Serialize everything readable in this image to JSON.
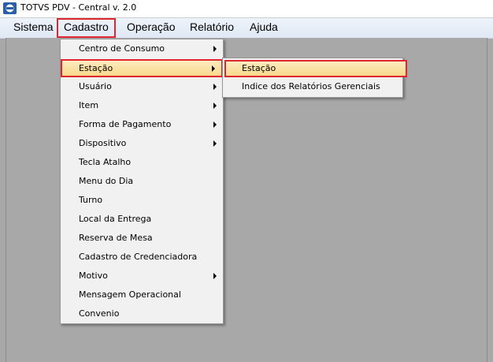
{
  "window": {
    "title": "TOTVS PDV - Central v. 2.0",
    "icon": "app-logo-icon"
  },
  "menubar": {
    "items": [
      {
        "label": "Sistema"
      },
      {
        "label": "Cadastro"
      },
      {
        "label": "Operação"
      },
      {
        "label": "Relatório"
      },
      {
        "label": "Ajuda"
      }
    ]
  },
  "cadastro_menu": {
    "items": [
      {
        "label": "Centro de Consumo",
        "has_submenu": true
      },
      {
        "label": "Estação",
        "has_submenu": true
      },
      {
        "label": "Usuário",
        "has_submenu": true
      },
      {
        "label": "Item",
        "has_submenu": true
      },
      {
        "label": "Forma de Pagamento",
        "has_submenu": true
      },
      {
        "label": "Dispositivo",
        "has_submenu": true
      },
      {
        "label": "Tecla Atalho",
        "has_submenu": false
      },
      {
        "label": "Menu do Dia",
        "has_submenu": false
      },
      {
        "label": "Turno",
        "has_submenu": false
      },
      {
        "label": "Local da Entrega",
        "has_submenu": false
      },
      {
        "label": "Reserva de Mesa",
        "has_submenu": false
      },
      {
        "label": "Cadastro de Credenciadora",
        "has_submenu": false
      },
      {
        "label": "Motivo",
        "has_submenu": true
      },
      {
        "label": "Mensagem Operacional",
        "has_submenu": false
      },
      {
        "label": "Convenio",
        "has_submenu": false
      }
    ]
  },
  "estacao_submenu": {
    "items": [
      {
        "label": "Estação"
      },
      {
        "label": "Indice dos Relatórios Gerenciais"
      }
    ]
  },
  "colors": {
    "highlight_border": "#e0262e",
    "selected_bg": "#f8d98b",
    "workspace": "#a8a8a8"
  }
}
